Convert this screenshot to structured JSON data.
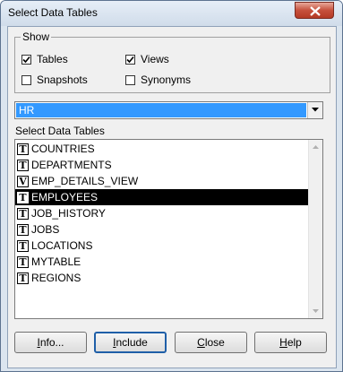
{
  "window": {
    "title": "Select Data Tables",
    "close_icon": "close-icon"
  },
  "show_group": {
    "title": "Show",
    "options": [
      {
        "label": "Tables",
        "checked": true
      },
      {
        "label": "Views",
        "checked": true
      },
      {
        "label": "Snapshots",
        "checked": false
      },
      {
        "label": "Synonyms",
        "checked": false
      }
    ]
  },
  "schema_select": {
    "value": "HR"
  },
  "table_list": {
    "label": "Select Data Tables",
    "items": [
      {
        "type": "T",
        "name": "COUNTRIES",
        "selected": false
      },
      {
        "type": "T",
        "name": "DEPARTMENTS",
        "selected": false
      },
      {
        "type": "V",
        "name": "EMP_DETAILS_VIEW",
        "selected": false
      },
      {
        "type": "T",
        "name": "EMPLOYEES",
        "selected": true
      },
      {
        "type": "T",
        "name": "JOB_HISTORY",
        "selected": false
      },
      {
        "type": "T",
        "name": "JOBS",
        "selected": false
      },
      {
        "type": "T",
        "name": "LOCATIONS",
        "selected": false
      },
      {
        "type": "T",
        "name": "MYTABLE",
        "selected": false
      },
      {
        "type": "T",
        "name": "REGIONS",
        "selected": false
      }
    ]
  },
  "buttons": {
    "info": {
      "mnemonic": "I",
      "rest": "nfo..."
    },
    "include": {
      "mnemonic": "I",
      "rest": "nclude"
    },
    "close": {
      "mnemonic": "C",
      "rest": "lose"
    },
    "help": {
      "mnemonic": "H",
      "rest": "elp"
    }
  },
  "colors": {
    "selection_highlight": "#3399ff",
    "selected_row": "#000000",
    "title_bar": "#dbe5ef"
  }
}
